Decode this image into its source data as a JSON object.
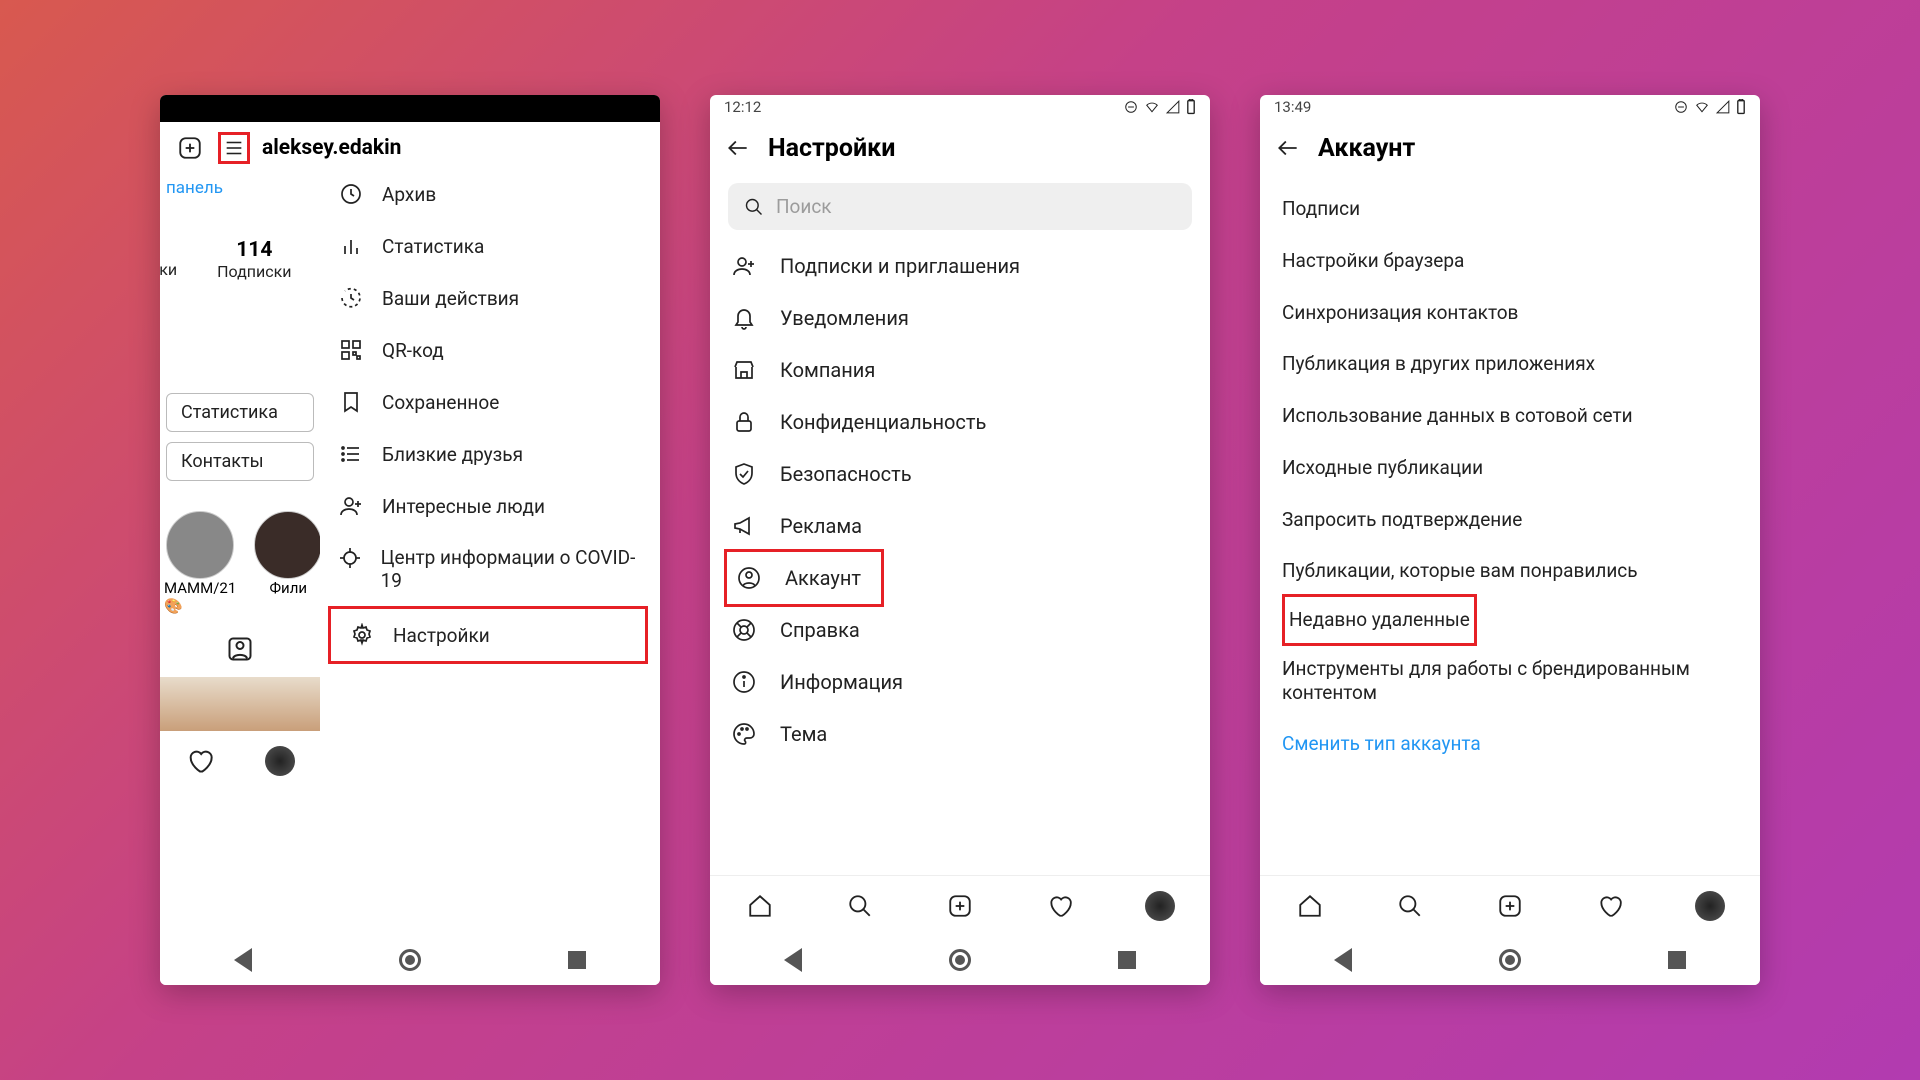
{
  "screen1": {
    "username": "aleksey.edakin",
    "panel_link": "панель",
    "stat": {
      "count": "114",
      "label": "Подписки"
    },
    "stat_left_label": "ики",
    "chips": [
      "Статистика",
      "Контакты"
    ],
    "stories": [
      {
        "label": "МАММ/21 🎨"
      },
      {
        "label": "Фили"
      }
    ],
    "menu": [
      {
        "icon": "archive",
        "label": "Архив"
      },
      {
        "icon": "stats",
        "label": "Статистика"
      },
      {
        "icon": "activity",
        "label": "Ваши действия"
      },
      {
        "icon": "qr",
        "label": "QR-код"
      },
      {
        "icon": "bookmark",
        "label": "Сохраненное"
      },
      {
        "icon": "closefriends",
        "label": "Близкие друзья"
      },
      {
        "icon": "discover",
        "label": "Интересные люди"
      },
      {
        "icon": "covid",
        "label": "Центр информации о COVID-19"
      }
    ],
    "settings_label": "Настройки"
  },
  "screen2": {
    "time": "12:12",
    "title": "Настройки",
    "search_placeholder": "Поиск",
    "items": [
      {
        "icon": "follow",
        "label": "Подписки и приглашения"
      },
      {
        "icon": "bell",
        "label": "Уведомления"
      },
      {
        "icon": "business",
        "label": "Компания"
      },
      {
        "icon": "lock",
        "label": "Конфиденциальность"
      },
      {
        "icon": "shield",
        "label": "Безопасность"
      },
      {
        "icon": "ads",
        "label": "Реклама"
      },
      {
        "icon": "account",
        "label": "Аккаунт",
        "highlight": true
      },
      {
        "icon": "help",
        "label": "Справка"
      },
      {
        "icon": "info",
        "label": "Информация"
      },
      {
        "icon": "theme",
        "label": "Тема"
      }
    ]
  },
  "screen3": {
    "time": "13:49",
    "title": "Аккаунт",
    "items": [
      {
        "label": "Подписи"
      },
      {
        "label": "Настройки браузера"
      },
      {
        "label": "Синхронизация контактов"
      },
      {
        "label": "Публикация в других приложениях"
      },
      {
        "label": "Использование данных в сотовой сети"
      },
      {
        "label": "Исходные публикации"
      },
      {
        "label": "Запросить подтверждение"
      },
      {
        "label": "Публикации, которые вам понравились"
      },
      {
        "label": "Недавно удаленные",
        "highlight": true
      },
      {
        "label": "Инструменты для работы с брендированным контентом"
      },
      {
        "label": "Сменить тип аккаунта",
        "link": true
      }
    ]
  }
}
